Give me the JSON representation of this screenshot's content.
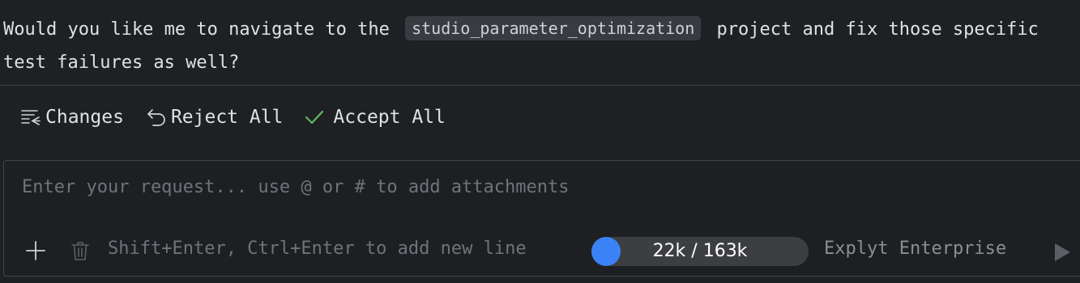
{
  "message": {
    "part1": "Would you like me to navigate to the",
    "code": "studio_parameter_optimization",
    "part2": "project and fix those specific test failures as well?"
  },
  "actions": {
    "changes_label": "Changes",
    "reject_label": "Reject All",
    "accept_label": "Accept All",
    "accept_color": "#5fb865"
  },
  "input": {
    "placeholder": "Enter your request... use @ or # to add attachments",
    "hint": "Shift+Enter, Ctrl+Enter to add new line"
  },
  "tokens": {
    "label": "22k / 163k",
    "used": 22,
    "total": 163,
    "dot_color": "#3b82f6"
  },
  "model": {
    "label": "Explyt Enterprise"
  },
  "icons": {
    "changes": "changes-list-icon",
    "reject": "undo-arrow-icon",
    "accept": "checkmark-icon",
    "add": "plus-icon",
    "delete": "trash-icon",
    "send": "play-icon"
  }
}
